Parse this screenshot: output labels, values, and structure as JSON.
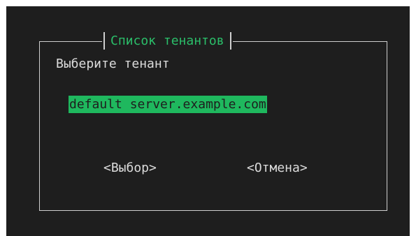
{
  "dialog": {
    "title": "Список тенантов",
    "prompt": "Выберите тенант",
    "items": [
      {
        "label": "default server.example.com",
        "selected": true
      }
    ],
    "buttons": {
      "select_label": "<Выбор>",
      "cancel_label": "<Отмена>"
    }
  },
  "colors": {
    "background": "#1e1e1e",
    "accent": "#2bbf6a",
    "selection": "#1fb85e",
    "text": "#dcdcdc",
    "border": "#cfcfcf"
  }
}
